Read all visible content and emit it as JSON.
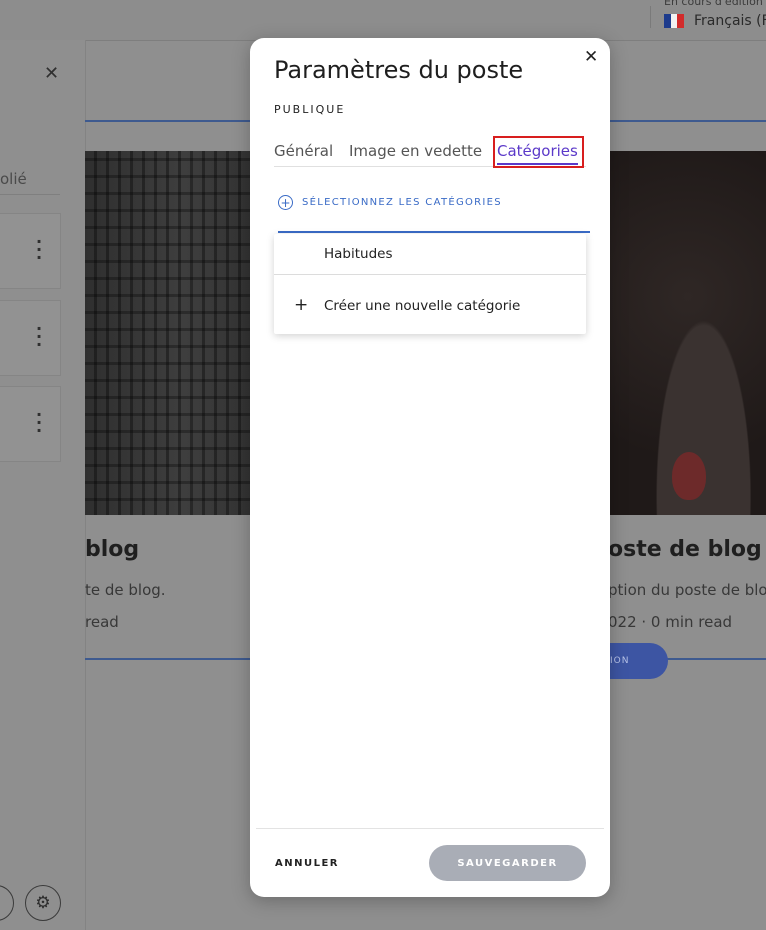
{
  "topbar": {
    "status_text": "En cours d'édition",
    "language_label": "Français (F",
    "flag_colors": [
      "#1d3b8c",
      "#f2f2f2",
      "#d22b2b"
    ]
  },
  "sidebar": {
    "publie_label": "olié"
  },
  "background_posts": {
    "left_title": "blog",
    "left_excerpt": "te de blog.",
    "left_meta": "read",
    "right_title": "oste de blog",
    "right_excerpt": "ption du poste de blo",
    "right_meta": "022 · 0 min read",
    "right_button": "ION"
  },
  "modal": {
    "title": "Paramètres du poste",
    "subtitle": "PUBLIQUE",
    "tabs": [
      {
        "label": "Général",
        "active": false
      },
      {
        "label": "Image en vedette",
        "active": false
      },
      {
        "label": "Catégories",
        "active": true
      }
    ],
    "select_categories_label": "SÉLECTIONNEZ LES CATÉGORIES",
    "dropdown_items": [
      {
        "label": "Habitudes"
      },
      {
        "label": "Créer une nouvelle catégorie",
        "icon": "+"
      }
    ],
    "cancel_label": "ANNULER",
    "save_label": "SAUVEGARDER"
  },
  "colors": {
    "accent": "#5b39c9",
    "link_blue": "#3a6bc6",
    "highlight_red": "#d81e1e",
    "save_button": "#a9adb6"
  }
}
